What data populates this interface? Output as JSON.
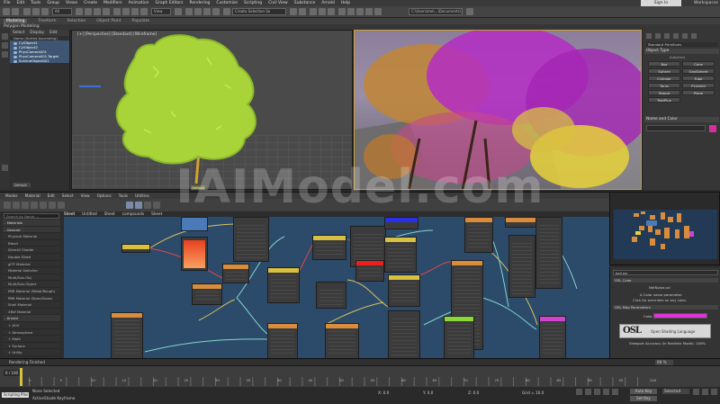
{
  "menubar": {
    "items": [
      "File",
      "Edit",
      "Tools",
      "Group",
      "Views",
      "Create",
      "Modifiers",
      "Animation",
      "Graph Editors",
      "Rendering",
      "Customize",
      "Scripting",
      "Civil View",
      "Substance",
      "Arnold",
      "Help"
    ],
    "signin": "Sign In",
    "workspace": "Workspaces"
  },
  "ribbon": {
    "tabs": [
      "Modeling",
      "Freeform",
      "Selection",
      "Object Paint",
      "Populate"
    ],
    "context": "Polygon Modeling"
  },
  "toolbar": {
    "view_dropdown": "View",
    "selset": "Create Selection Se"
  },
  "scene": {
    "tabs": [
      "Select",
      "Display",
      "Edit"
    ],
    "column": "Name (Sorted Ascending)",
    "items": [
      "CylObject1",
      "CylObject2",
      "PhysCamera001",
      "PhysCamera001.Target",
      "SunlineObject001"
    ],
    "layer": "Default"
  },
  "viewports": {
    "left_label": "[+] [Perspective] [Standard] [Wireframe]",
    "bottom_label": "Default"
  },
  "command_panel": {
    "rollout_object_type": "Object Type",
    "autogrid": "AutoGrid",
    "buttons": [
      "Box",
      "Cone",
      "Sphere",
      "GeoSphere",
      "Cylinder",
      "Tube",
      "Torus",
      "Pyramid",
      "Teapot",
      "Plane",
      "TextPlus"
    ],
    "rollout_name_color": "Name and Color",
    "category": "Standard Primitives",
    "color_swatch": "#d42f9c"
  },
  "material_editor": {
    "menu": [
      "Modes",
      "Material",
      "Edit",
      "Select",
      "View",
      "Options",
      "Tools",
      "Utilities"
    ],
    "search_placeholder": "Search by Name ...",
    "browser": [
      {
        "label": "- Materials",
        "header": true
      },
      {
        "label": "- General",
        "header": true
      },
      {
        "label": "Physical Material"
      },
      {
        "label": "Blend"
      },
      {
        "label": "DirectX Shader"
      },
      {
        "label": "Double Sided"
      },
      {
        "label": "glTF Material"
      },
      {
        "label": "Material Switcher"
      },
      {
        "label": "Multi/Sub-Obj"
      },
      {
        "label": "Multi/Sub-Object"
      },
      {
        "label": "PBR Material (Metal/Rough)"
      },
      {
        "label": "PBR Material (Spec/Gloss)"
      },
      {
        "label": "Shell Material"
      },
      {
        "label": "XRef Material"
      },
      {
        "label": "- Arnold",
        "header": true
      },
      {
        "label": "+ AOV"
      },
      {
        "label": "+ Atmosphere"
      },
      {
        "label": "+ Math"
      },
      {
        "label": "+ Surface"
      },
      {
        "label": "+ Utility"
      }
    ],
    "graph_tabs": [
      "Sheet",
      "Untitled",
      "Sheet",
      "compounds",
      "Sheet"
    ],
    "params": {
      "node_name": "ball.osl",
      "osl_code": "OSL Code",
      "file": "NetNoise.osl",
      "desc1": "A Color value parameter.",
      "desc2": "Click for overrides on any color.",
      "map_params": "OSL Map Parameters",
      "color_label": "Color",
      "color": "#e233d8",
      "osl_logo": "OSL",
      "osl_full": "Open Shading Language",
      "footer": "Viewport Accuracy (In Realistic Mode): 100%"
    },
    "render_status": "Rendering Finished",
    "zoom": "68 %"
  },
  "timeline": {
    "frame": "0 / 100",
    "ticks": [
      "0",
      "5",
      "10",
      "15",
      "20",
      "25",
      "30",
      "35",
      "40",
      "45",
      "50",
      "55",
      "60",
      "65",
      "70",
      "75",
      "80",
      "85",
      "90",
      "95",
      "100"
    ]
  },
  "status": {
    "maxscript": "Scripting Ples",
    "selected": "None Selected",
    "activeshade": "ActiveShade Keyframe",
    "x": "X: 0.0",
    "y": "Y: 0.0",
    "z": "Z: 0.0",
    "grid": "Grid = 10.0",
    "autokey": "Auto Key",
    "setkey": "Set Key",
    "selected_dd": "Selected"
  },
  "watermark": "IAIModel.com"
}
